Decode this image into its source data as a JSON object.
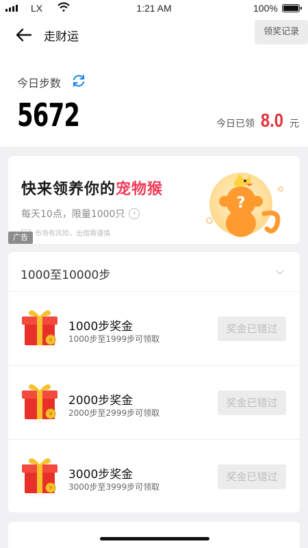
{
  "status_bar": {
    "carrier": "LX",
    "time": "1:21 AM",
    "battery_percent": "100%",
    "battery_level": 1.0
  },
  "nav": {
    "title": "走财运",
    "records_label": "领奖记录"
  },
  "steps": {
    "label": "今日步数",
    "value": "5672",
    "earned_label": "今日已领",
    "earned_amount": "8.0",
    "earned_unit": "元"
  },
  "ad": {
    "title_prefix": "快来领养你的",
    "title_highlight": "宠物猴",
    "subtitle": "每天10点，限量1000只",
    "risk_text": "市场有风险，出借需谨慎",
    "tag": "广告",
    "colors": {
      "highlight": "#f03c5a"
    }
  },
  "rewards": {
    "range_label": "1000至10000步",
    "items": [
      {
        "title": "1000步奖金",
        "subtitle": "1000步至1999步可领取",
        "button": "奖金已错过"
      },
      {
        "title": "2000步奖金",
        "subtitle": "2000步至2999步可领取",
        "button": "奖金已错过"
      },
      {
        "title": "3000步奖金",
        "subtitle": "3000步至3999步可领取",
        "button": "奖金已错过"
      }
    ]
  },
  "colors": {
    "accent_red": "#e0323a",
    "refresh_blue": "#1e88e5",
    "gift_red": "#e8302a",
    "gift_gold": "#f6c12c"
  }
}
